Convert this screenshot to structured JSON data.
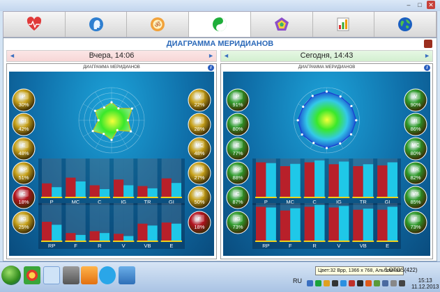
{
  "tabs": [
    {
      "icon": "heart-icon",
      "active": false
    },
    {
      "icon": "head-profile-icon",
      "active": false
    },
    {
      "icon": "om-symbol-icon",
      "active": false
    },
    {
      "icon": "yin-yang-icon",
      "active": true
    },
    {
      "icon": "pentagon-icon",
      "active": false
    },
    {
      "icon": "bar-chart-icon",
      "active": false
    },
    {
      "icon": "globe-icon",
      "active": false
    }
  ],
  "page_title": "ДИАГРАММА МЕРИДИАНОВ",
  "left": {
    "header": "Вчера, 14:06",
    "panel_title": "ДИАГРАММА МЕРИДИАНОВ",
    "radar_values": [
      0.55,
      0.42,
      0.72,
      0.5,
      0.68,
      0.35,
      0.6,
      0.48,
      0.66,
      0.4,
      0.58,
      0.45
    ],
    "meridians_left": [
      {
        "label": "P",
        "value": "30%",
        "color": "gold"
      },
      {
        "label": "GI",
        "value": "42%",
        "color": "gold"
      },
      {
        "label": "E",
        "value": "48%",
        "color": "gold"
      },
      {
        "label": "RP",
        "value": "51%",
        "color": "gold"
      },
      {
        "label": "C",
        "value": "18%",
        "color": "red"
      },
      {
        "label": "IG",
        "value": "25%",
        "color": "gold"
      }
    ],
    "meridians_right": [
      {
        "label": "V",
        "value": "22%",
        "color": "gold"
      },
      {
        "label": "R",
        "value": "28%",
        "color": "gold"
      },
      {
        "label": "MC",
        "value": "48%",
        "color": "gold"
      },
      {
        "label": "TR",
        "value": "27%",
        "color": "gold"
      },
      {
        "label": "VB",
        "value": "50%",
        "color": "gold"
      },
      {
        "label": "F",
        "value": "18%",
        "color": "red"
      }
    ],
    "bars_top_labels": [
      "P",
      "MC",
      "C",
      "IG",
      "TR",
      "GI"
    ],
    "bars_bottom_labels": [
      "RP",
      "F",
      "R",
      "V",
      "VB",
      "E"
    ],
    "bars_top": [
      [
        0.35,
        0.25
      ],
      [
        0.5,
        0.4
      ],
      [
        0.3,
        0.2
      ],
      [
        0.45,
        0.3
      ],
      [
        0.28,
        0.22
      ],
      [
        0.48,
        0.36
      ]
    ],
    "bars_bottom": [
      [
        0.5,
        0.42
      ],
      [
        0.2,
        0.15
      ],
      [
        0.25,
        0.2
      ],
      [
        0.18,
        0.12
      ],
      [
        0.45,
        0.4
      ],
      [
        0.48,
        0.45
      ]
    ]
  },
  "right": {
    "header": "Сегодня, 14:43",
    "panel_title": "ДИАГРАММА МЕРИДИАНОВ",
    "radar_values": [
      0.88,
      0.84,
      0.87,
      0.9,
      0.86,
      0.82,
      0.85,
      0.8,
      0.87,
      0.88,
      0.83,
      0.86
    ],
    "meridians_left": [
      {
        "label": "P",
        "value": "91%",
        "color": "green"
      },
      {
        "label": "GI",
        "value": "80%",
        "color": "green"
      },
      {
        "label": "E",
        "value": "77%",
        "color": "green"
      },
      {
        "label": "RP",
        "value": "88%",
        "color": "green"
      },
      {
        "label": "C",
        "value": "87%",
        "color": "green"
      },
      {
        "label": "IG",
        "value": "73%",
        "color": "green"
      }
    ],
    "meridians_right": [
      {
        "label": "V",
        "value": "90%",
        "color": "green"
      },
      {
        "label": "R",
        "value": "86%",
        "color": "green"
      },
      {
        "label": "MC",
        "value": "80%",
        "color": "green"
      },
      {
        "label": "TR",
        "value": "82%",
        "color": "green"
      },
      {
        "label": "VB",
        "value": "85%",
        "color": "green"
      },
      {
        "label": "F",
        "value": "73%",
        "color": "green"
      }
    ],
    "bars_top_labels": [
      "P",
      "MC",
      "C",
      "IG",
      "TR",
      "GI"
    ],
    "bars_bottom_labels": [
      "RP",
      "F",
      "R",
      "V",
      "VB",
      "E"
    ],
    "bars_top": [
      [
        0.9,
        0.88
      ],
      [
        0.8,
        0.86
      ],
      [
        0.9,
        0.95
      ],
      [
        0.85,
        0.92
      ],
      [
        0.8,
        0.85
      ],
      [
        0.82,
        0.9
      ]
    ],
    "bars_bottom": [
      [
        0.9,
        0.88
      ],
      [
        0.8,
        0.86
      ],
      [
        0.9,
        0.95
      ],
      [
        0.88,
        0.92
      ],
      [
        0.82,
        0.85
      ],
      [
        0.82,
        0.9
      ]
    ]
  },
  "taskbar": {
    "lang": "RU",
    "tooltip": "Цвет:32 Bpp, 1366 x 768, Альбомная",
    "lotos": "LOTOS(422)",
    "time": "15:13",
    "date": "11.12.2013"
  },
  "colors": {
    "gold": "#c8a21a",
    "red": "#b3121e",
    "green": "#2e9a2a",
    "accent": "#2a68b8"
  }
}
